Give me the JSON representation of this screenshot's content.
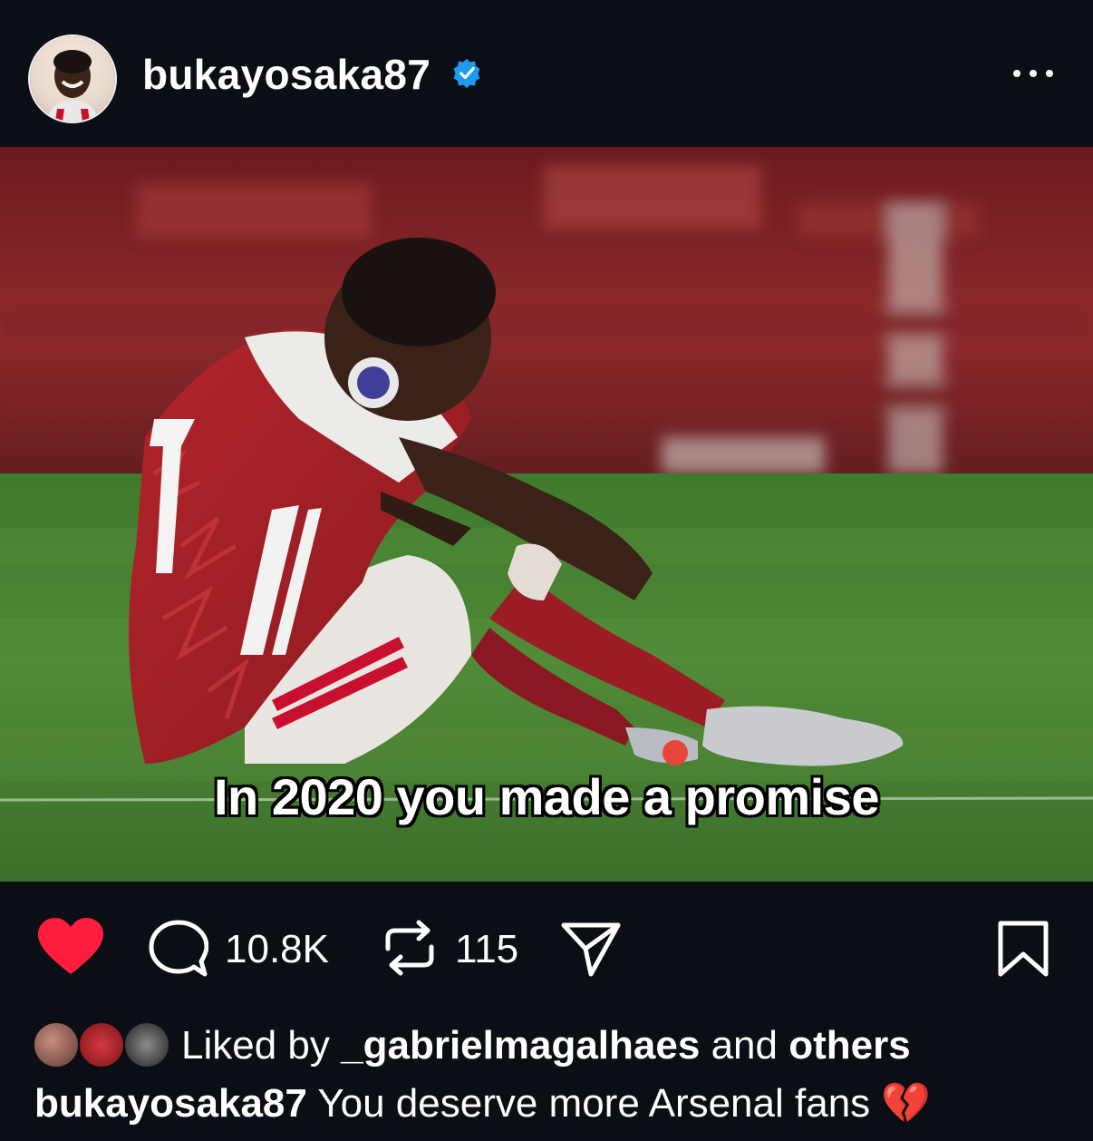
{
  "post": {
    "username": "bukayosaka87",
    "overlay_caption": "In 2020 you made a promise",
    "comments_count": "10.8K",
    "reposts_count": "115",
    "liked_by_prefix": "Liked by",
    "liked_by_user": "_gabrielmagalhaes",
    "liked_by_connector": "and",
    "liked_by_others": "others",
    "caption_user": "bukayosaka87",
    "caption_text": "You deserve more Arsenal fans",
    "caption_emoji": "💔"
  },
  "colors": {
    "background": "#0b0e14",
    "like_red": "#ff1f3d",
    "verified_blue": "#1d9bf0"
  },
  "icons": [
    "avatar",
    "verified-badge-icon",
    "more-options-icon",
    "heart-icon",
    "comment-icon",
    "repost-icon",
    "share-icon",
    "bookmark-icon"
  ],
  "like_avatars": [
    "liker-avatar-1",
    "liker-avatar-2",
    "liker-avatar-3"
  ]
}
